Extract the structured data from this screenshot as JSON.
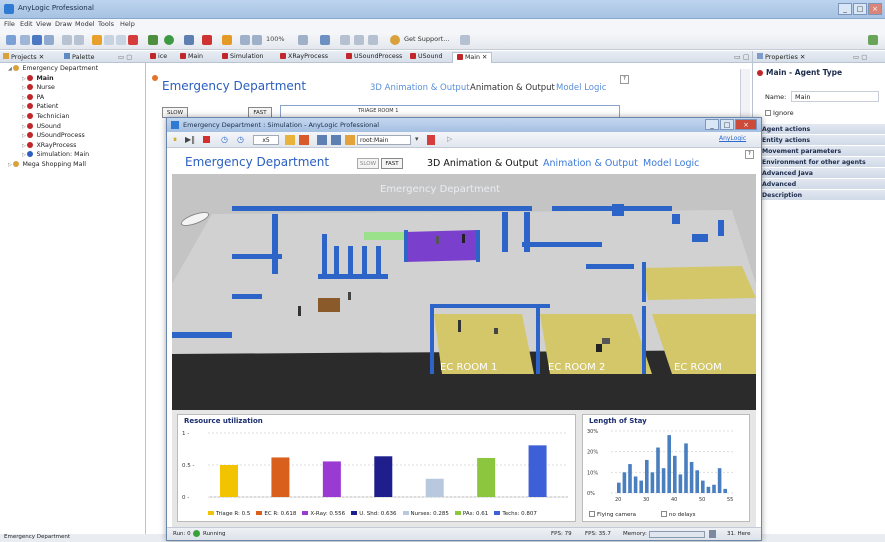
{
  "app": {
    "title": "AnyLogic Professional"
  },
  "menu": [
    "File",
    "Edit",
    "View",
    "Draw",
    "Model",
    "Tools",
    "Help"
  ],
  "toolbar": {
    "zoom": "100%",
    "get_support": "Get Support..."
  },
  "left_panel": {
    "tabs": [
      "Projects",
      "Palette"
    ],
    "tree": [
      {
        "label": "Emergency Department",
        "level": 0
      },
      {
        "label": "Main",
        "level": 1
      },
      {
        "label": "Nurse",
        "level": 1
      },
      {
        "label": "PA",
        "level": 1
      },
      {
        "label": "Patient",
        "level": 1
      },
      {
        "label": "Technician",
        "level": 1
      },
      {
        "label": "USound",
        "level": 1
      },
      {
        "label": "USoundProcess",
        "level": 1
      },
      {
        "label": "XRayProcess",
        "level": 1
      },
      {
        "label": "Simulation: Main",
        "level": 1
      },
      {
        "label": "Mega Shopping Mall",
        "level": 0
      }
    ]
  },
  "editor_tabs": [
    "ice",
    "Main",
    "Simulation",
    "XRayProcess",
    "USoundProcess",
    "USound",
    "Main"
  ],
  "canvas": {
    "title": "Emergency Department",
    "links": [
      "3D Animation & Output",
      "Animation & Output",
      "Model Logic"
    ],
    "slow": "SLOW",
    "fast": "FAST",
    "triage_label": "TRIAGE ROOM 1"
  },
  "properties": {
    "tab": "Properties",
    "header": "Main - Agent Type",
    "name_label": "Name:",
    "name_value": "Main",
    "ignore_label": "Ignore",
    "sections": [
      "Agent actions",
      "Entity actions",
      "Movement parameters",
      "Environment for other agents",
      "Advanced Java",
      "Advanced",
      "Description"
    ]
  },
  "status_bar": {
    "text": "Emergency Department"
  },
  "sim": {
    "title": "Emergency Department : Simulation - AnyLogic Professional",
    "speed": "x5",
    "agent": "root:Main",
    "nav": {
      "title": "Emergency Department",
      "slow": "SLOW",
      "fast": "FAST",
      "tab1": "3D Animation & Output",
      "tab2": "Animation & Output",
      "tab3": "Model Logic"
    },
    "scene_title": "Emergency Department",
    "room_labels": [
      "EC ROOM 1",
      "EC ROOM 2",
      "EC ROOM"
    ],
    "status": {
      "run": "Run: 0",
      "state": "Running",
      "fps1": "FPS: 79",
      "fps2": "FPS: 35.7",
      "memory": "Memory:",
      "tail": "31. Here"
    },
    "anylogic_label": "AnyLogic"
  },
  "colors": {
    "accent": "#2a5fc0",
    "wall": "#2d64c8",
    "floor": "#bcbcbc",
    "room": "#d3c76a",
    "triage": "#7a3fcc"
  },
  "chart_data": [
    {
      "type": "bar",
      "title": "Resource utilization",
      "ylim": [
        0,
        1
      ],
      "yticks": [
        "1 -",
        "0.5 -",
        "0 -"
      ],
      "categories": [
        "Triage R",
        "EC R",
        "X-Ray",
        "U. Shd",
        "Nurses",
        "PAs",
        "Techs"
      ],
      "values": [
        0.5,
        0.618,
        0.556,
        0.636,
        0.285,
        0.61,
        0.807
      ],
      "colors": [
        "#f2c400",
        "#d9601c",
        "#9a3ad2",
        "#1e1e8c",
        "#b8c8de",
        "#8cc63e",
        "#3d5fd8"
      ],
      "legend": [
        "Triage R: 0.5",
        "EC R: 0.618",
        "X-Ray: 0.556",
        "U. Shd: 0.636",
        "Nurses: 0.285",
        "PAs: 0.61",
        "Techs: 0.807"
      ]
    },
    {
      "type": "bar",
      "title": "Length of Stay",
      "yticks": [
        "30%",
        "20%",
        "10%",
        "0%"
      ],
      "xticks": [
        "20",
        "30",
        "40",
        "50",
        "55"
      ],
      "values": [
        0.05,
        0.1,
        0.14,
        0.08,
        0.06,
        0.16,
        0.1,
        0.22,
        0.12,
        0.28,
        0.18,
        0.09,
        0.24,
        0.15,
        0.11,
        0.06,
        0.03,
        0.04,
        0.12,
        0.02
      ],
      "checkboxes": [
        "Flying camera",
        "no delays"
      ]
    }
  ]
}
